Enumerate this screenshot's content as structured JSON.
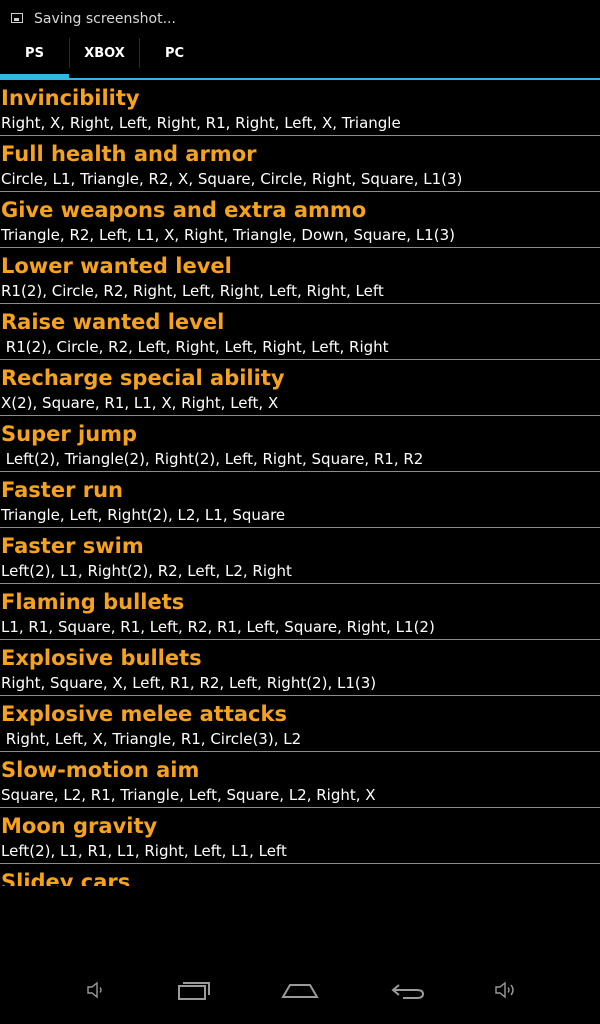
{
  "status": {
    "notification": "Saving screenshot..."
  },
  "tabs": [
    {
      "label": "PS",
      "selected": true
    },
    {
      "label": "XBOX",
      "selected": false
    },
    {
      "label": "PC",
      "selected": false
    }
  ],
  "accent_color": "#33b5e5",
  "title_color": "#f7a21d",
  "cheats": [
    {
      "title": "Invincibility",
      "code": "Right, X, Right, Left, Right, R1, Right, Left, X, Triangle"
    },
    {
      "title": "Full health and armor",
      "code": "Circle, L1, Triangle, R2, X, Square, Circle, Right, Square, L1(3)"
    },
    {
      "title": "Give weapons and extra ammo",
      "code": "Triangle, R2, Left, L1, X, Right, Triangle, Down, Square, L1(3)"
    },
    {
      "title": "Lower wanted level",
      "code": "R1(2), Circle, R2, Right, Left, Right, Left, Right, Left"
    },
    {
      "title": "Raise wanted level",
      "code": " R1(2), Circle, R2, Left, Right, Left, Right, Left, Right"
    },
    {
      "title": "Recharge special ability",
      "code": "X(2), Square, R1, L1, X, Right, Left, X"
    },
    {
      "title": "Super jump",
      "code": " Left(2), Triangle(2), Right(2), Left, Right, Square, R1, R2"
    },
    {
      "title": "Faster run",
      "code": "Triangle, Left, Right(2), L2, L1, Square"
    },
    {
      "title": "Faster swim",
      "code": "Left(2), L1, Right(2), R2, Left, L2, Right"
    },
    {
      "title": "Flaming bullets",
      "code": "L1, R1, Square, R1, Left, R2, R1, Left, Square, Right, L1(2)"
    },
    {
      "title": "Explosive bullets",
      "code": "Right, Square, X, Left, R1, R2, Left, Right(2), L1(3)"
    },
    {
      "title": "Explosive melee attacks",
      "code": " Right, Left, X, Triangle, R1, Circle(3), L2"
    },
    {
      "title": "Slow-motion aim",
      "code": "Square, L2, R1, Triangle, Left, Square, L2, Right, X"
    },
    {
      "title": "Moon gravity",
      "code": "Left(2), L1, R1, L1, Right, Left, L1, Left"
    },
    {
      "title": "Slidey cars",
      "code": ""
    }
  ],
  "nav": {
    "icons": [
      "volume-down-icon",
      "recent-apps-icon",
      "home-icon",
      "back-icon",
      "volume-up-icon"
    ]
  }
}
